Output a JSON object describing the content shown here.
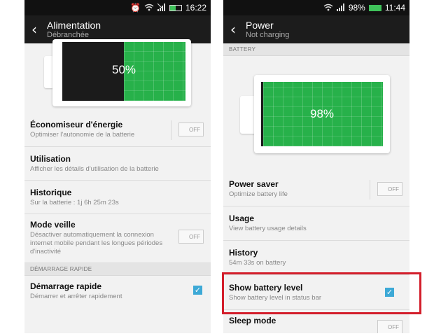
{
  "left": {
    "status": {
      "time": "16:22"
    },
    "header": {
      "title": "Alimentation",
      "subtitle": "Débranchée"
    },
    "battery": {
      "percent_label": "50%",
      "level": 0.5
    },
    "items": [
      {
        "title": "Économiseur d'énergie",
        "sub": "Optimiser l'autonomie de la batterie",
        "toggle": "OFF"
      },
      {
        "title": "Utilisation",
        "sub": "Afficher les détails d'utilisation de la batterie"
      },
      {
        "title": "Historique",
        "sub": "Sur la batterie : 1j 6h 25m 23s"
      },
      {
        "title": "Mode veille",
        "sub": "Désactiver automatiquement la connexion internet mobile pendant les longues périodes d'inactivité",
        "toggle": "OFF"
      }
    ],
    "section": "DÉMARRAGE RAPIDE",
    "fastboot": {
      "title": "Démarrage rapide",
      "sub": "Démarrer et arrêter rapidement",
      "checked": true
    }
  },
  "right": {
    "status": {
      "battery_text": "98%",
      "time": "11:44"
    },
    "header": {
      "title": "Power",
      "subtitle": "Not charging"
    },
    "section": "BATTERY",
    "battery": {
      "percent_label": "98%",
      "level": 0.98
    },
    "items": [
      {
        "title": "Power saver",
        "sub": "Optimize battery life",
        "toggle": "OFF"
      },
      {
        "title": "Usage",
        "sub": "View battery usage details"
      },
      {
        "title": "History",
        "sub": "54m 33s on battery"
      },
      {
        "title": "Show battery level",
        "sub": "Show battery level in status bar",
        "checked": true
      },
      {
        "title": "Sleep mode",
        "toggle": "OFF"
      }
    ]
  },
  "icons": {
    "alarm": "alarm-clock-icon",
    "wifi": "wifi-icon",
    "signal": "signal-icon",
    "back": "back-arrow-icon",
    "check": "checkmark-icon"
  },
  "colors": {
    "battery_green": "#27b14a",
    "checkbox_blue": "#3da9d6",
    "highlight_red": "#d31e2b"
  }
}
